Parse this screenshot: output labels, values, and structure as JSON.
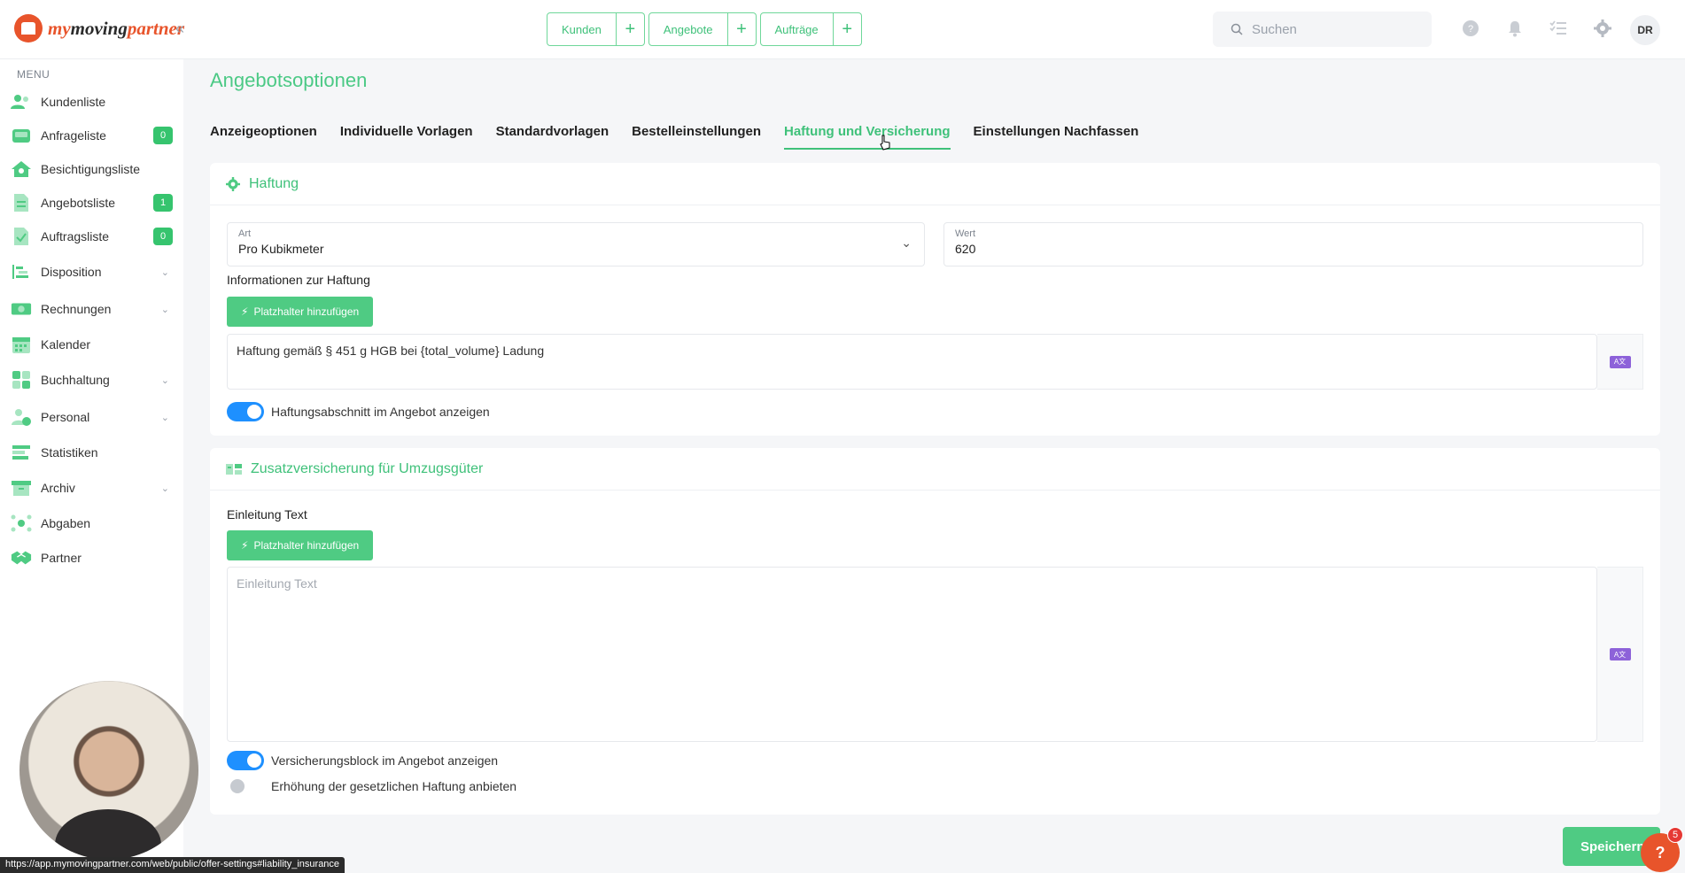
{
  "brand": {
    "name_part1": "my",
    "name_part2": "moving",
    "name_part3": "partner"
  },
  "topnav": [
    {
      "label": "Kunden"
    },
    {
      "label": "Angebote"
    },
    {
      "label": "Aufträge"
    }
  ],
  "search": {
    "placeholder": "Suchen"
  },
  "user": {
    "initials": "DR"
  },
  "sidebar": {
    "menu_label": "MENU",
    "items": [
      {
        "label": "Kundenliste"
      },
      {
        "label": "Anfrageliste",
        "badge": "0"
      },
      {
        "label": "Besichtigungsliste"
      },
      {
        "label": "Angebotsliste",
        "badge": "1"
      },
      {
        "label": "Auftragsliste",
        "badge": "0"
      },
      {
        "label": "Disposition"
      },
      {
        "label": "Rechnungen"
      },
      {
        "label": "Kalender"
      },
      {
        "label": "Buchhaltung"
      },
      {
        "label": "Personal"
      },
      {
        "label": "Statistiken"
      },
      {
        "label": "Archiv"
      },
      {
        "label": "Abgaben"
      },
      {
        "label": "Partner"
      }
    ]
  },
  "page": {
    "title": "Angebotsoptionen"
  },
  "tabs": [
    {
      "label": "Anzeigeoptionen"
    },
    {
      "label": "Individuelle Vorlagen"
    },
    {
      "label": "Standardvorlagen"
    },
    {
      "label": "Bestelleinstellungen"
    },
    {
      "label": "Haftung und Versicherung",
      "active": true
    },
    {
      "label": "Einstellungen Nachfassen"
    }
  ],
  "liability": {
    "title": "Haftung",
    "art_label": "Art",
    "art_value": "Pro Kubikmeter",
    "wert_label": "Wert",
    "wert_value": "620",
    "info_label": "Informationen zur Haftung",
    "placeholder_button": "Platzhalter hinzufügen",
    "text": "Haftung gemäß § 451 g HGB bei {total_volume} Ladung",
    "toggle_label": "Haftungsabschnitt im Angebot anzeigen"
  },
  "insurance": {
    "title": "Zusatzversicherung für Umzugsgüter",
    "intro_label": "Einleitung Text",
    "placeholder_button": "Platzhalter hinzufügen",
    "intro_placeholder": "Einleitung Text",
    "toggle1_label": "Versicherungsblock im Angebot anzeigen",
    "toggle2_label": "Erhöhung der gesetzlichen Haftung anbieten"
  },
  "save_button": "Speichern",
  "help_badge": "5",
  "status_url": "https://app.mymovingpartner.com/web/public/offer-settings#liability_insurance",
  "colors": {
    "accent": "#3fc17a",
    "toggle_on": "#1e90ff",
    "brand": "#e8542b"
  }
}
